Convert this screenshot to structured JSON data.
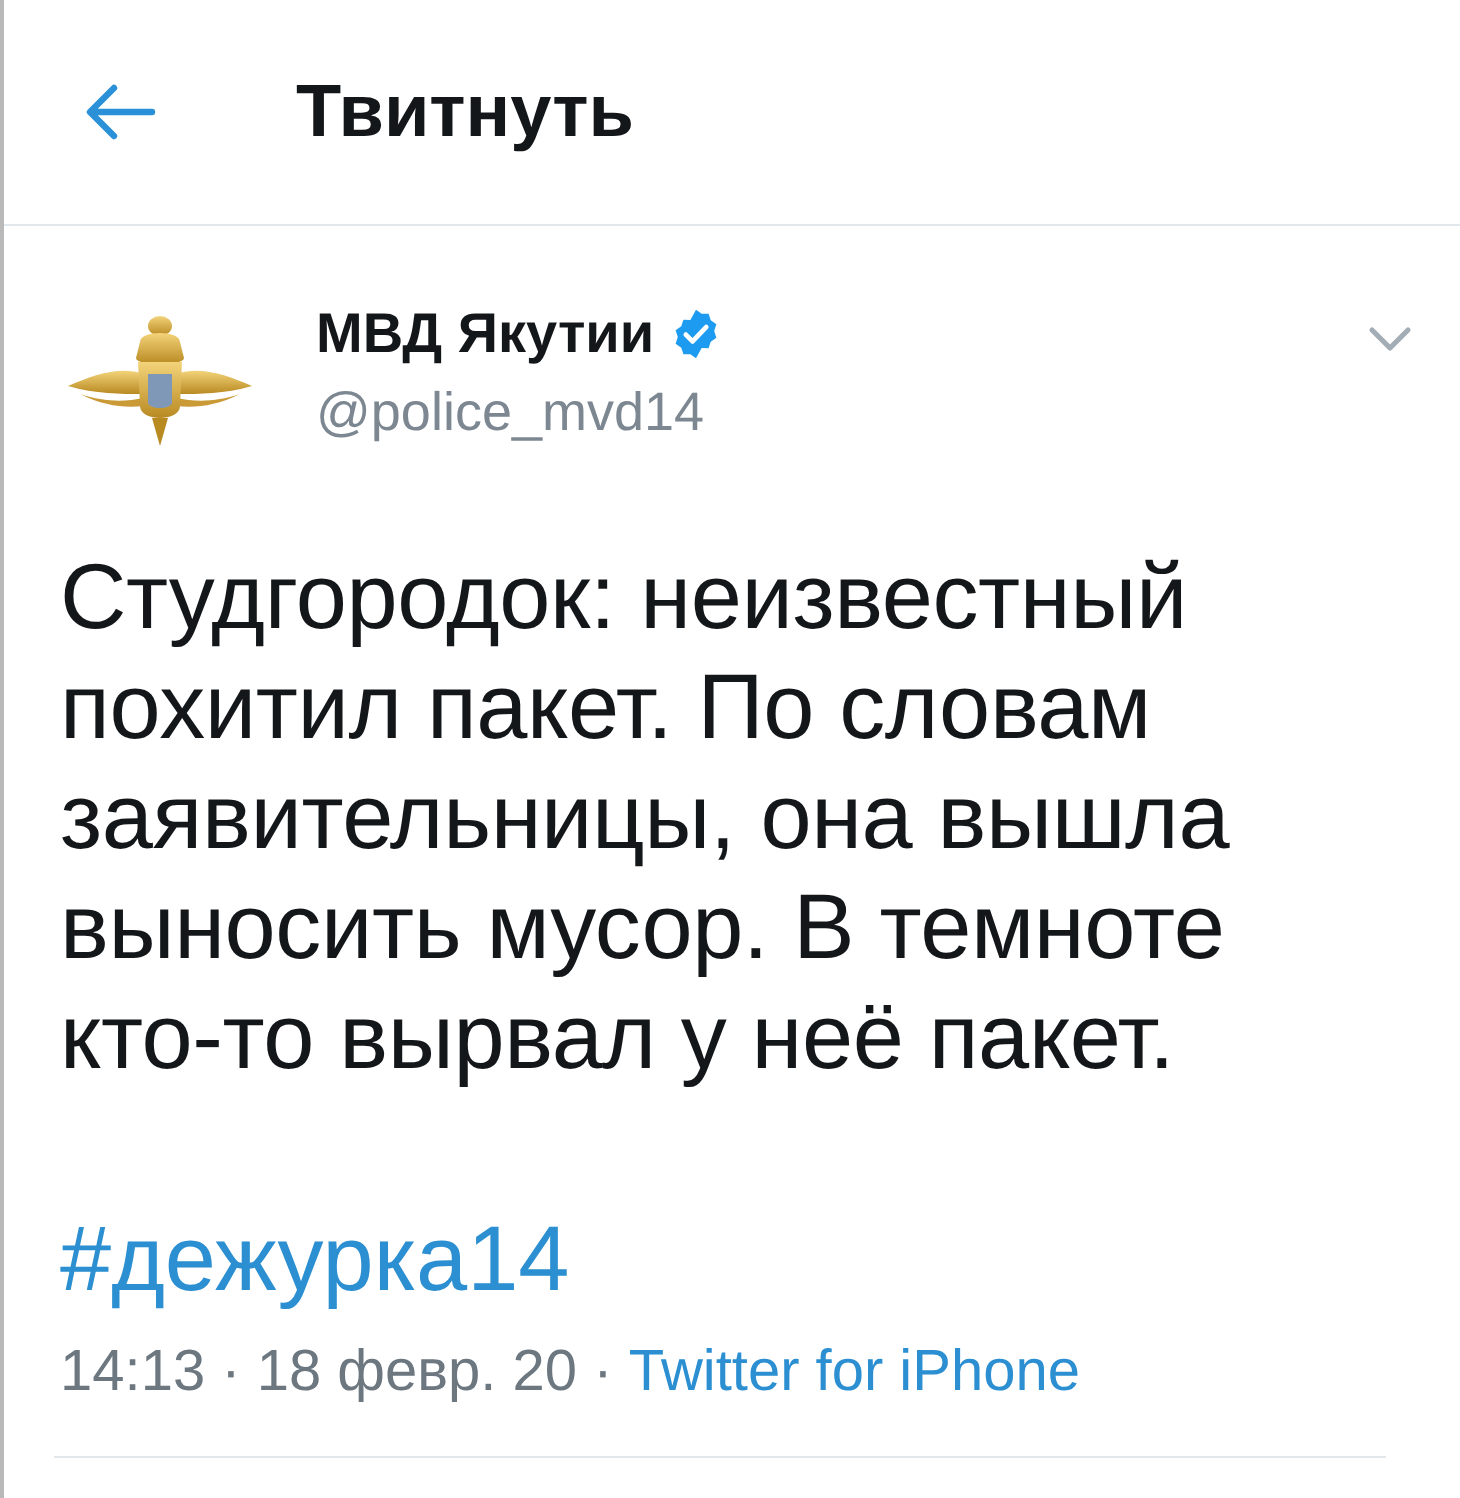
{
  "header": {
    "title": "Твитнуть"
  },
  "tweet": {
    "author": {
      "name": "МВД Якутии",
      "verified": true,
      "handle": "@police_mvd14"
    },
    "text": "Студгородок: неизвестный похитил пакет. По словам заявительницы, она вышла выносить мусор. В темноте кто-то вырвал у неё пакет.",
    "hashtag": "#дежурка14",
    "timestamp": "14:13 · 18 февр. 20 · ",
    "source": "Twitter for iPhone"
  }
}
